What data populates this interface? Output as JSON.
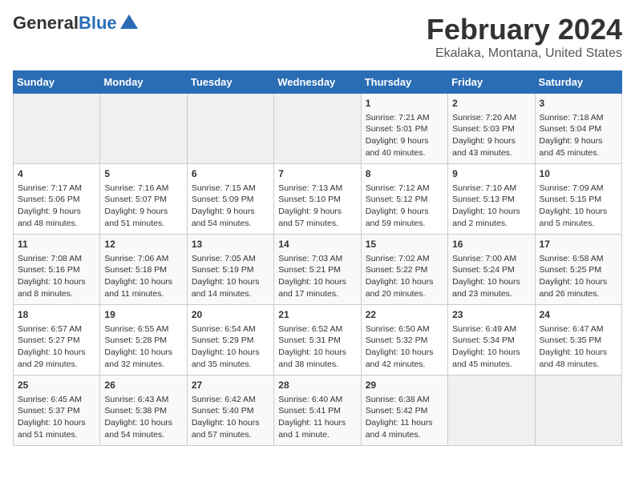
{
  "header": {
    "logo_general": "General",
    "logo_blue": "Blue",
    "title": "February 2024",
    "subtitle": "Ekalaka, Montana, United States"
  },
  "weekdays": [
    "Sunday",
    "Monday",
    "Tuesday",
    "Wednesday",
    "Thursday",
    "Friday",
    "Saturday"
  ],
  "weeks": [
    [
      {
        "day": "",
        "info": ""
      },
      {
        "day": "",
        "info": ""
      },
      {
        "day": "",
        "info": ""
      },
      {
        "day": "",
        "info": ""
      },
      {
        "day": "1",
        "info": "Sunrise: 7:21 AM\nSunset: 5:01 PM\nDaylight: 9 hours\nand 40 minutes."
      },
      {
        "day": "2",
        "info": "Sunrise: 7:20 AM\nSunset: 5:03 PM\nDaylight: 9 hours\nand 43 minutes."
      },
      {
        "day": "3",
        "info": "Sunrise: 7:18 AM\nSunset: 5:04 PM\nDaylight: 9 hours\nand 45 minutes."
      }
    ],
    [
      {
        "day": "4",
        "info": "Sunrise: 7:17 AM\nSunset: 5:06 PM\nDaylight: 9 hours\nand 48 minutes."
      },
      {
        "day": "5",
        "info": "Sunrise: 7:16 AM\nSunset: 5:07 PM\nDaylight: 9 hours\nand 51 minutes."
      },
      {
        "day": "6",
        "info": "Sunrise: 7:15 AM\nSunset: 5:09 PM\nDaylight: 9 hours\nand 54 minutes."
      },
      {
        "day": "7",
        "info": "Sunrise: 7:13 AM\nSunset: 5:10 PM\nDaylight: 9 hours\nand 57 minutes."
      },
      {
        "day": "8",
        "info": "Sunrise: 7:12 AM\nSunset: 5:12 PM\nDaylight: 9 hours\nand 59 minutes."
      },
      {
        "day": "9",
        "info": "Sunrise: 7:10 AM\nSunset: 5:13 PM\nDaylight: 10 hours\nand 2 minutes."
      },
      {
        "day": "10",
        "info": "Sunrise: 7:09 AM\nSunset: 5:15 PM\nDaylight: 10 hours\nand 5 minutes."
      }
    ],
    [
      {
        "day": "11",
        "info": "Sunrise: 7:08 AM\nSunset: 5:16 PM\nDaylight: 10 hours\nand 8 minutes."
      },
      {
        "day": "12",
        "info": "Sunrise: 7:06 AM\nSunset: 5:18 PM\nDaylight: 10 hours\nand 11 minutes."
      },
      {
        "day": "13",
        "info": "Sunrise: 7:05 AM\nSunset: 5:19 PM\nDaylight: 10 hours\nand 14 minutes."
      },
      {
        "day": "14",
        "info": "Sunrise: 7:03 AM\nSunset: 5:21 PM\nDaylight: 10 hours\nand 17 minutes."
      },
      {
        "day": "15",
        "info": "Sunrise: 7:02 AM\nSunset: 5:22 PM\nDaylight: 10 hours\nand 20 minutes."
      },
      {
        "day": "16",
        "info": "Sunrise: 7:00 AM\nSunset: 5:24 PM\nDaylight: 10 hours\nand 23 minutes."
      },
      {
        "day": "17",
        "info": "Sunrise: 6:58 AM\nSunset: 5:25 PM\nDaylight: 10 hours\nand 26 minutes."
      }
    ],
    [
      {
        "day": "18",
        "info": "Sunrise: 6:57 AM\nSunset: 5:27 PM\nDaylight: 10 hours\nand 29 minutes."
      },
      {
        "day": "19",
        "info": "Sunrise: 6:55 AM\nSunset: 5:28 PM\nDaylight: 10 hours\nand 32 minutes."
      },
      {
        "day": "20",
        "info": "Sunrise: 6:54 AM\nSunset: 5:29 PM\nDaylight: 10 hours\nand 35 minutes."
      },
      {
        "day": "21",
        "info": "Sunrise: 6:52 AM\nSunset: 5:31 PM\nDaylight: 10 hours\nand 38 minutes."
      },
      {
        "day": "22",
        "info": "Sunrise: 6:50 AM\nSunset: 5:32 PM\nDaylight: 10 hours\nand 42 minutes."
      },
      {
        "day": "23",
        "info": "Sunrise: 6:49 AM\nSunset: 5:34 PM\nDaylight: 10 hours\nand 45 minutes."
      },
      {
        "day": "24",
        "info": "Sunrise: 6:47 AM\nSunset: 5:35 PM\nDaylight: 10 hours\nand 48 minutes."
      }
    ],
    [
      {
        "day": "25",
        "info": "Sunrise: 6:45 AM\nSunset: 5:37 PM\nDaylight: 10 hours\nand 51 minutes."
      },
      {
        "day": "26",
        "info": "Sunrise: 6:43 AM\nSunset: 5:38 PM\nDaylight: 10 hours\nand 54 minutes."
      },
      {
        "day": "27",
        "info": "Sunrise: 6:42 AM\nSunset: 5:40 PM\nDaylight: 10 hours\nand 57 minutes."
      },
      {
        "day": "28",
        "info": "Sunrise: 6:40 AM\nSunset: 5:41 PM\nDaylight: 11 hours\nand 1 minute."
      },
      {
        "day": "29",
        "info": "Sunrise: 6:38 AM\nSunset: 5:42 PM\nDaylight: 11 hours\nand 4 minutes."
      },
      {
        "day": "",
        "info": ""
      },
      {
        "day": "",
        "info": ""
      }
    ]
  ]
}
